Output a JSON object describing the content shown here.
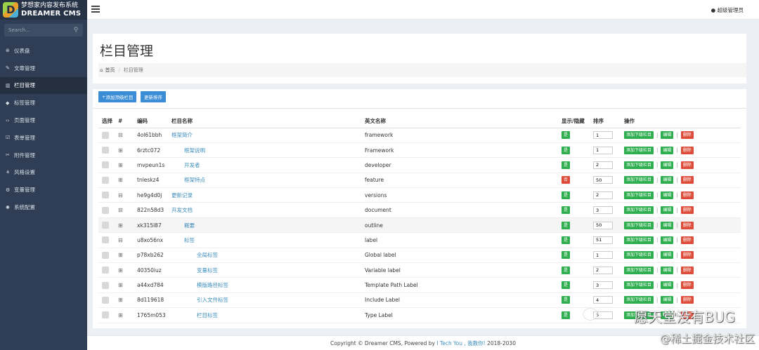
{
  "app": {
    "name_cn": "梦想家内容发布系统",
    "name_en": "DREAMER CMS"
  },
  "search": {
    "placeholder": "Search..."
  },
  "sidebar": {
    "items": [
      {
        "label": "仪表盘",
        "icon": "dashboard-icon",
        "glyph": "⊛"
      },
      {
        "label": "文章管理",
        "icon": "edit-icon",
        "glyph": "✎"
      },
      {
        "label": "栏目管理",
        "icon": "columns-icon",
        "glyph": "▥"
      },
      {
        "label": "标签管理",
        "icon": "tag-icon",
        "glyph": "◆"
      },
      {
        "label": "页面管理",
        "icon": "code-icon",
        "glyph": "‹›"
      },
      {
        "label": "表单管理",
        "icon": "form-icon",
        "glyph": "☑"
      },
      {
        "label": "附件管理",
        "icon": "paperclip-icon",
        "glyph": "✂"
      },
      {
        "label": "风格设置",
        "icon": "style-icon",
        "glyph": "⚘"
      },
      {
        "label": "变量管理",
        "icon": "variable-icon",
        "glyph": "⚙"
      },
      {
        "label": "系统配置",
        "icon": "gear-icon",
        "glyph": "✺"
      }
    ]
  },
  "topbar": {
    "user": "超级管理员",
    "user_icon": "user-icon"
  },
  "page": {
    "title": "栏目管理",
    "breadcrumb_home": "首页",
    "breadcrumb_current": "栏目管理"
  },
  "toolbar": {
    "add_top": "添加顶级栏目",
    "update_sort": "更新排序"
  },
  "table": {
    "headers": {
      "select": "选择",
      "index": "#",
      "code": "编码",
      "name": "栏目名称",
      "en_name": "英文名称",
      "visible": "显示/隐藏",
      "sort": "排序",
      "actions": "操作"
    },
    "action_add_child": "添加下级栏目",
    "action_edit": "编辑",
    "action_delete": "删除",
    "rows": [
      {
        "tree": "⊟",
        "code": "4ol61bbh",
        "name": "框架简介",
        "level": 0,
        "en": "framework",
        "visible": "是",
        "visible_state": "shown",
        "sort": "1"
      },
      {
        "tree": "⊞",
        "code": "6rztc072",
        "name": "框架说明",
        "level": 1,
        "en": "Framework",
        "visible": "是",
        "visible_state": "shown",
        "sort": "1"
      },
      {
        "tree": "⊞",
        "code": "mvpeun1s",
        "name": "开发者",
        "level": 1,
        "en": "developer",
        "visible": "是",
        "visible_state": "shown",
        "sort": "2"
      },
      {
        "tree": "⊞",
        "code": "tnleskz4",
        "name": "框架特点",
        "level": 1,
        "en": "feature",
        "visible": "否",
        "visible_state": "hidden",
        "sort": "50"
      },
      {
        "tree": "⊟",
        "code": "he9g4d0j",
        "name": "更新记录",
        "level": 0,
        "en": "versions",
        "visible": "是",
        "visible_state": "shown",
        "sort": "2"
      },
      {
        "tree": "⊟",
        "code": "822n58d3",
        "name": "开发文档",
        "level": 0,
        "en": "document",
        "visible": "是",
        "visible_state": "shown",
        "sort": "3"
      },
      {
        "tree": "⊞",
        "code": "xk315l87",
        "name": "概要",
        "level": 1,
        "en": "outline",
        "visible": "是",
        "visible_state": "shown",
        "sort": "50",
        "highlight": true
      },
      {
        "tree": "⊟",
        "code": "u8xo56nx",
        "name": "标签",
        "level": 1,
        "en": "label",
        "visible": "是",
        "visible_state": "shown",
        "sort": "51"
      },
      {
        "tree": "⊞",
        "code": "p78xb262",
        "name": "全局标签",
        "level": 2,
        "en": "Global label",
        "visible": "是",
        "visible_state": "shown",
        "sort": "1"
      },
      {
        "tree": "⊞",
        "code": "40350iuz",
        "name": "变量标签",
        "level": 2,
        "en": "Variable label",
        "visible": "是",
        "visible_state": "shown",
        "sort": "2"
      },
      {
        "tree": "⊞",
        "code": "a44xd784",
        "name": "模版路径标签",
        "level": 2,
        "en": "Template Path Label",
        "visible": "是",
        "visible_state": "shown",
        "sort": "3"
      },
      {
        "tree": "⊞",
        "code": "8d119618",
        "name": "引入文件标签",
        "level": 2,
        "en": "Include Label",
        "visible": "是",
        "visible_state": "shown",
        "sort": "4"
      },
      {
        "tree": "⊞",
        "code": "1765m053",
        "name": "栏目标签",
        "level": 2,
        "en": "Type Label",
        "visible": "是",
        "visible_state": "shown",
        "sort": "5"
      }
    ]
  },
  "footer": {
    "prefix": "Copyright © Dreamer CMS, Powered by",
    "link": "I Tech You , 我教你!",
    "years": "2018-2030"
  },
  "watermark": {
    "main": "愿天堂没有BUG",
    "sub": "@稀土掘金技术社区"
  },
  "colors": {
    "sidebar_bg": "#2f3e54",
    "primary_blue": "#3b8dd6",
    "success_green": "#2eae4f",
    "danger_red": "#dd4b39",
    "link_blue": "#3c8dbc"
  }
}
